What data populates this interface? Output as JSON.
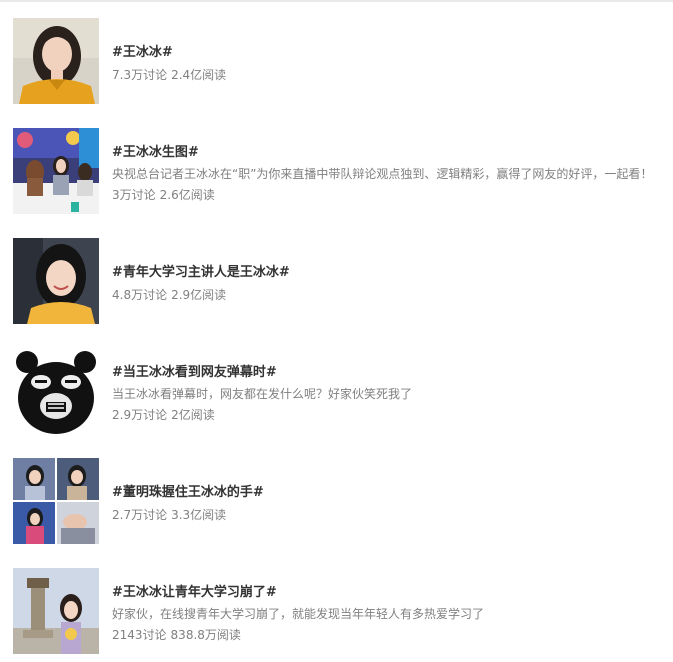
{
  "topics": [
    {
      "title": "#王冰冰#",
      "description": "",
      "discussions": "7.3万讨论",
      "reads": "2.4亿阅读",
      "thumbnail": "woman-yellow-top-portrait"
    },
    {
      "title": "#王冰冰生图#",
      "description": "央视总台记者王冰冰在“职”为你来直播中带队辩论观点独到、逻辑精彩，赢得了网友的好评，一起看！",
      "discussions": "3万讨论",
      "reads": "2.6亿阅读",
      "thumbnail": "livestream-studio-panel"
    },
    {
      "title": "#青年大学习主讲人是王冰冰#",
      "description": "",
      "discussions": "4.8万讨论",
      "reads": "2.9亿阅读",
      "thumbnail": "woman-smiling-portrait"
    },
    {
      "title": "#当王冰冰看到网友弹幕时#",
      "description": "当王冰冰看弹幕时，网友都在发什么呢？好家伙笑死我了",
      "discussions": "2.9万讨论",
      "reads": "2亿阅读",
      "thumbnail": "black-bear-meme"
    },
    {
      "title": "#董明珠握住王冰冰的手#",
      "description": "",
      "discussions": "2.7万讨论",
      "reads": "3.3亿阅读",
      "thumbnail": "photo-collage-2x2"
    },
    {
      "title": "#王冰冰让青年大学习崩了#",
      "description": "好家伙，在线搜青年大学习崩了，就能发现当年年轻人有多热爱学习了",
      "discussions": "2143讨论",
      "reads": "838.8万阅读",
      "thumbnail": "woman-at-monument"
    }
  ],
  "colors": {
    "title": "#333333",
    "meta": "#808080",
    "divider": "#e9e9e9"
  }
}
